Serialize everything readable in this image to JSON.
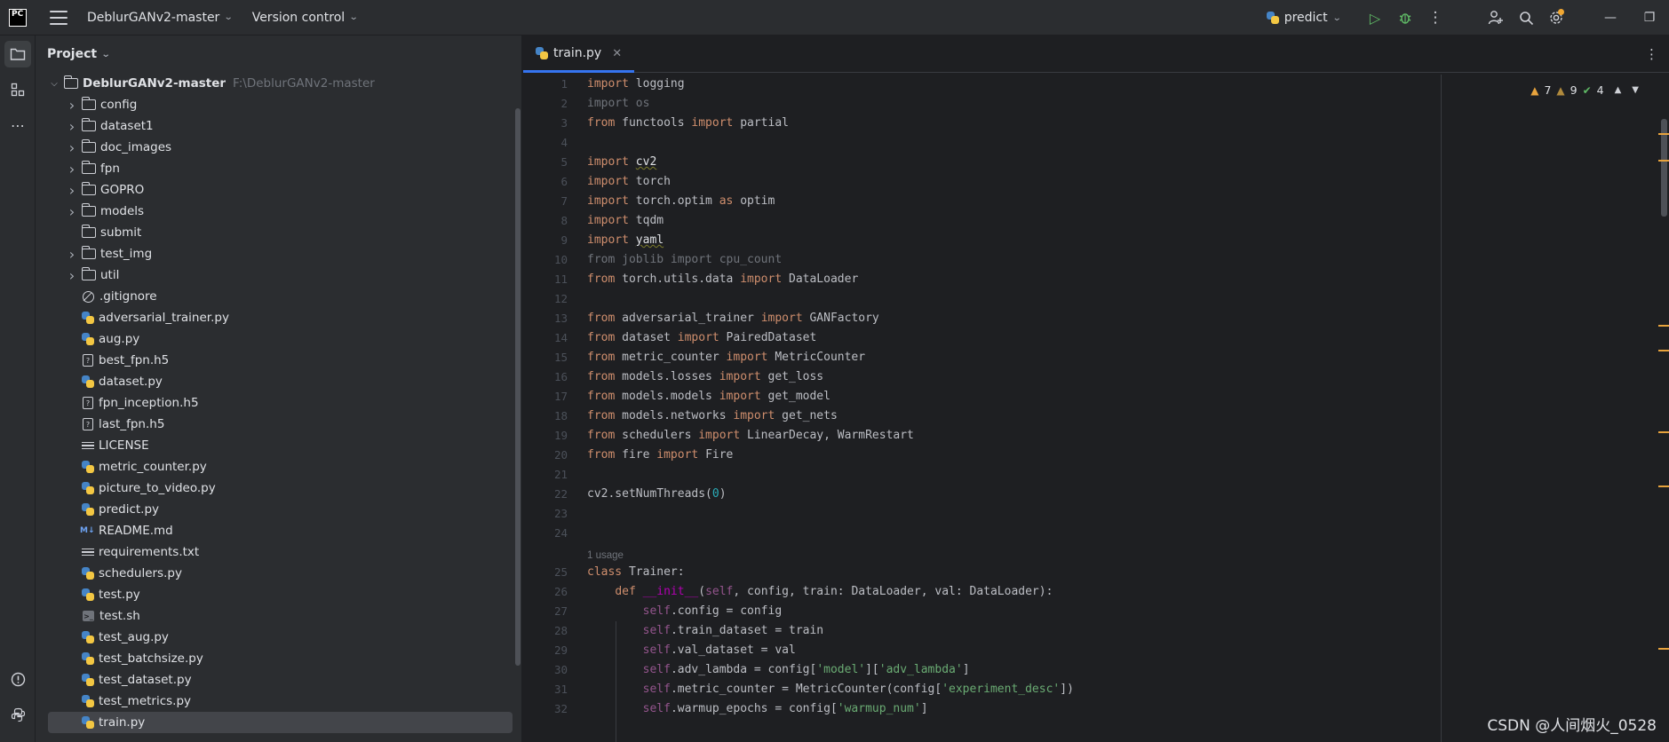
{
  "titlebar": {
    "logo_text": "PC",
    "project_name": "DeblurGANv2-master",
    "vcs_label": "Version control",
    "run_config": "predict"
  },
  "project_panel": {
    "title": "Project",
    "root": {
      "name": "DeblurGANv2-master",
      "path": "F:\\DeblurGANv2-master"
    },
    "items": [
      {
        "name": "config",
        "type": "folder",
        "expandable": true
      },
      {
        "name": "dataset1",
        "type": "folder",
        "expandable": true
      },
      {
        "name": "doc_images",
        "type": "folder",
        "expandable": true
      },
      {
        "name": "fpn",
        "type": "folder",
        "expandable": true
      },
      {
        "name": "GOPRO",
        "type": "folder",
        "expandable": true
      },
      {
        "name": "models",
        "type": "folder",
        "expandable": true
      },
      {
        "name": "submit",
        "type": "folder",
        "expandable": false
      },
      {
        "name": "test_img",
        "type": "folder",
        "expandable": true
      },
      {
        "name": "util",
        "type": "folder",
        "expandable": true
      },
      {
        "name": ".gitignore",
        "type": "ignore"
      },
      {
        "name": "adversarial_trainer.py",
        "type": "py"
      },
      {
        "name": "aug.py",
        "type": "py"
      },
      {
        "name": "best_fpn.h5",
        "type": "unknown"
      },
      {
        "name": "dataset.py",
        "type": "py"
      },
      {
        "name": "fpn_inception.h5",
        "type": "unknown"
      },
      {
        "name": "last_fpn.h5",
        "type": "unknown"
      },
      {
        "name": "LICENSE",
        "type": "text"
      },
      {
        "name": "metric_counter.py",
        "type": "py"
      },
      {
        "name": "picture_to_video.py",
        "type": "py"
      },
      {
        "name": "predict.py",
        "type": "py"
      },
      {
        "name": "README.md",
        "type": "md"
      },
      {
        "name": "requirements.txt",
        "type": "text"
      },
      {
        "name": "schedulers.py",
        "type": "py"
      },
      {
        "name": "test.py",
        "type": "py"
      },
      {
        "name": "test.sh",
        "type": "sh"
      },
      {
        "name": "test_aug.py",
        "type": "py"
      },
      {
        "name": "test_batchsize.py",
        "type": "py"
      },
      {
        "name": "test_dataset.py",
        "type": "py"
      },
      {
        "name": "test_metrics.py",
        "type": "py"
      },
      {
        "name": "train.py",
        "type": "py",
        "selected": true
      }
    ]
  },
  "editor": {
    "tab_label": "train.py",
    "inspections": {
      "warnings": "7",
      "weak_warnings": "9",
      "ok": "4"
    },
    "usage_hint": "1 usage",
    "lines": [
      {
        "n": "1",
        "tokens": [
          [
            "kw",
            "import"
          ],
          [
            "plain",
            " logging"
          ]
        ]
      },
      {
        "n": "2",
        "tokens": [
          [
            "faded",
            "import os"
          ]
        ]
      },
      {
        "n": "3",
        "tokens": [
          [
            "kw",
            "from"
          ],
          [
            "plain",
            " functools "
          ],
          [
            "kw",
            "import"
          ],
          [
            "plain",
            " partial"
          ]
        ]
      },
      {
        "n": "4",
        "tokens": []
      },
      {
        "n": "5",
        "tokens": [
          [
            "kw",
            "import"
          ],
          [
            "plain",
            " "
          ],
          [
            "squig",
            "cv2"
          ]
        ]
      },
      {
        "n": "6",
        "tokens": [
          [
            "kw",
            "import"
          ],
          [
            "plain",
            " torch"
          ]
        ]
      },
      {
        "n": "7",
        "tokens": [
          [
            "kw",
            "import"
          ],
          [
            "plain",
            " torch.optim "
          ],
          [
            "kw",
            "as"
          ],
          [
            "plain",
            " optim"
          ]
        ]
      },
      {
        "n": "8",
        "tokens": [
          [
            "kw",
            "import"
          ],
          [
            "plain",
            " tqdm"
          ]
        ]
      },
      {
        "n": "9",
        "tokens": [
          [
            "kw",
            "import"
          ],
          [
            "plain",
            " "
          ],
          [
            "squig",
            "yaml"
          ]
        ]
      },
      {
        "n": "10",
        "tokens": [
          [
            "faded",
            "from joblib import cpu_count"
          ]
        ]
      },
      {
        "n": "11",
        "tokens": [
          [
            "kw",
            "from"
          ],
          [
            "plain",
            " torch.utils.data "
          ],
          [
            "kw",
            "import"
          ],
          [
            "plain",
            " DataLoader"
          ]
        ]
      },
      {
        "n": "12",
        "tokens": []
      },
      {
        "n": "13",
        "tokens": [
          [
            "kw",
            "from"
          ],
          [
            "plain",
            " adversarial_trainer "
          ],
          [
            "kw",
            "import"
          ],
          [
            "plain",
            " GANFactory"
          ]
        ]
      },
      {
        "n": "14",
        "tokens": [
          [
            "kw",
            "from"
          ],
          [
            "plain",
            " dataset "
          ],
          [
            "kw",
            "import"
          ],
          [
            "plain",
            " PairedDataset"
          ]
        ]
      },
      {
        "n": "15",
        "tokens": [
          [
            "kw",
            "from"
          ],
          [
            "plain",
            " metric_counter "
          ],
          [
            "kw",
            "import"
          ],
          [
            "plain",
            " MetricCounter"
          ]
        ]
      },
      {
        "n": "16",
        "tokens": [
          [
            "kw",
            "from"
          ],
          [
            "plain",
            " models.losses "
          ],
          [
            "kw",
            "import"
          ],
          [
            "plain",
            " get_loss"
          ]
        ]
      },
      {
        "n": "17",
        "tokens": [
          [
            "kw",
            "from"
          ],
          [
            "plain",
            " models.models "
          ],
          [
            "kw",
            "import"
          ],
          [
            "plain",
            " get_model"
          ]
        ]
      },
      {
        "n": "18",
        "tokens": [
          [
            "kw",
            "from"
          ],
          [
            "plain",
            " models.networks "
          ],
          [
            "kw",
            "import"
          ],
          [
            "plain",
            " get_nets"
          ]
        ]
      },
      {
        "n": "19",
        "tokens": [
          [
            "kw",
            "from"
          ],
          [
            "plain",
            " schedulers "
          ],
          [
            "kw",
            "import"
          ],
          [
            "plain",
            " LinearDecay, WarmRestart"
          ]
        ]
      },
      {
        "n": "20",
        "tokens": [
          [
            "kw",
            "from"
          ],
          [
            "plain",
            " fire "
          ],
          [
            "kw",
            "import"
          ],
          [
            "plain",
            " Fire"
          ]
        ]
      },
      {
        "n": "21",
        "tokens": []
      },
      {
        "n": "22",
        "tokens": [
          [
            "plain",
            "cv2.setNumThreads("
          ],
          [
            "num",
            "0"
          ],
          [
            "plain",
            ")"
          ]
        ]
      },
      {
        "n": "23",
        "tokens": []
      },
      {
        "n": "24",
        "tokens": []
      },
      {
        "n": "",
        "inlay": true,
        "tokens": []
      },
      {
        "n": "25",
        "tokens": [
          [
            "kw",
            "class"
          ],
          [
            "plain",
            " Trainer:"
          ]
        ]
      },
      {
        "n": "26",
        "tokens": [
          [
            "plain",
            "    "
          ],
          [
            "kw",
            "def"
          ],
          [
            "plain",
            " "
          ],
          [
            "dunder",
            "__init__"
          ],
          [
            "plain",
            "("
          ],
          [
            "self",
            "self"
          ],
          [
            "plain",
            ", config, train: DataLoader, val: DataLoader):"
          ]
        ]
      },
      {
        "n": "27",
        "tokens": [
          [
            "plain",
            "        "
          ],
          [
            "self",
            "self"
          ],
          [
            "plain",
            ".config = config"
          ]
        ]
      },
      {
        "n": "28",
        "tokens": [
          [
            "plain",
            "        "
          ],
          [
            "self",
            "self"
          ],
          [
            "plain",
            ".train_dataset = train"
          ]
        ]
      },
      {
        "n": "29",
        "tokens": [
          [
            "plain",
            "        "
          ],
          [
            "self",
            "self"
          ],
          [
            "plain",
            ".val_dataset = val"
          ]
        ]
      },
      {
        "n": "30",
        "tokens": [
          [
            "plain",
            "        "
          ],
          [
            "self",
            "self"
          ],
          [
            "plain",
            ".adv_lambda = config["
          ],
          [
            "str",
            "'model'"
          ],
          [
            "plain",
            "]["
          ],
          [
            "str",
            "'adv_lambda'"
          ],
          [
            "plain",
            "]"
          ]
        ]
      },
      {
        "n": "31",
        "tokens": [
          [
            "plain",
            "        "
          ],
          [
            "self",
            "self"
          ],
          [
            "plain",
            ".metric_counter = MetricCounter(config["
          ],
          [
            "str",
            "'experiment_desc'"
          ],
          [
            "plain",
            "])"
          ]
        ]
      },
      {
        "n": "32",
        "tokens": [
          [
            "plain",
            "        "
          ],
          [
            "self",
            "self"
          ],
          [
            "plain",
            ".warmup_epochs = config["
          ],
          [
            "str",
            "'warmup_num'"
          ],
          [
            "plain",
            "]"
          ]
        ]
      }
    ]
  },
  "watermark": "CSDN @人间烟火_0528",
  "colors": {
    "accent": "#3574f0",
    "keyword": "#cf8e6d",
    "string": "#6aab73",
    "self": "#94558d",
    "warning": "#e8a33d"
  }
}
